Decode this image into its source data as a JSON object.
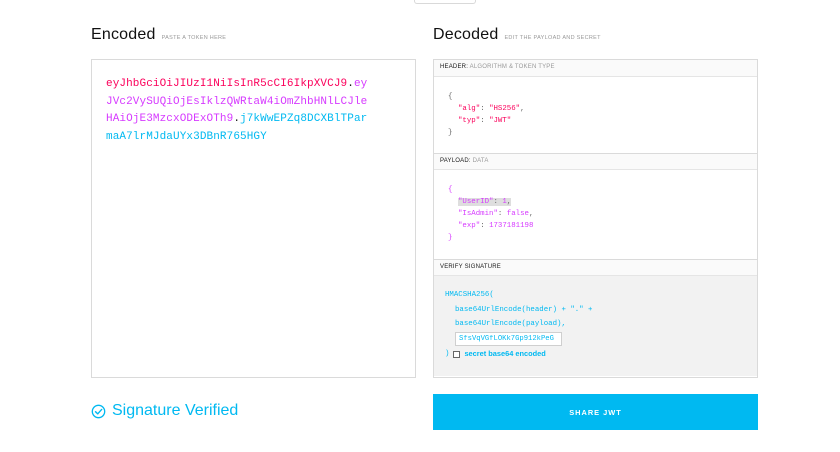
{
  "encoded": {
    "title": "Encoded",
    "hint": "PASTE A TOKEN HERE",
    "token_header": "eyJhbGciOiJIUzI1NiIsInR5cCI6IkpXVCJ9",
    "dot1": ".",
    "token_payload": "eyJVc2VySUQiOjEsIklzQWRtaW4iOmZhbHNlLCJleHAiOjE3MzcxODExOTh9",
    "dot2": ".",
    "token_signature": "j7kWwEPZq8DCXBlTParmaA7lrMJdaUYx3DBnR765HGY"
  },
  "decoded": {
    "title": "Decoded",
    "hint": "EDIT THE PAYLOAD AND SECRET",
    "header_section": {
      "label": "HEADER:",
      "sublabel": "ALGORITHM & TOKEN TYPE"
    },
    "header_json": {
      "open": "{",
      "alg_key": "\"alg\"",
      "alg_value": "\"HS256\"",
      "typ_key": "\"typ\"",
      "typ_value": "\"JWT\"",
      "close": "}"
    },
    "payload_section": {
      "label": "PAYLOAD:",
      "sublabel": "DATA"
    },
    "payload_json": {
      "open": "{",
      "userid_key": "\"UserID\"",
      "userid_value": "1",
      "isadmin_key": "\"IsAdmin\"",
      "isadmin_value": "false",
      "exp_key": "\"exp\"",
      "exp_value": "1737181198",
      "close": "}"
    },
    "verify_section": {
      "label": "VERIFY SIGNATURE"
    },
    "verify": {
      "fn_open": "HMACSHA256(",
      "line1": "base64UrlEncode(header) + \".\" +",
      "line2": "base64UrlEncode(payload),",
      "secret_value": "SfsVqVGfLOKk7Gp912kPeG",
      "fn_close": ")",
      "secret_checkbox_label": "secret base64 encoded"
    }
  },
  "status": {
    "text": "Signature Verified"
  },
  "share_button": {
    "label": "SHARE JWT"
  },
  "colors": {
    "header": "#fb015b",
    "payload": "#d63aff",
    "signature": "#00b9f1"
  }
}
